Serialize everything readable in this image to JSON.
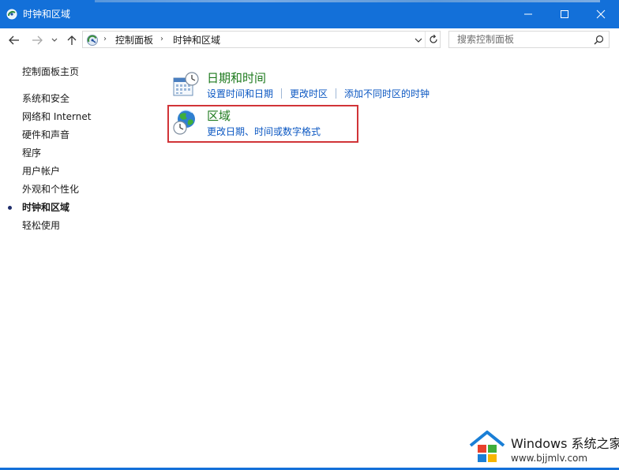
{
  "window": {
    "title": "时钟和区域"
  },
  "navigation": {
    "breadcrumb": [
      "控制面板",
      "时钟和区域"
    ],
    "search_placeholder": "搜索控制面板"
  },
  "sidebar": {
    "home": "控制面板主页",
    "items": [
      {
        "label": "系统和安全"
      },
      {
        "label": "网络和 Internet"
      },
      {
        "label": "硬件和声音"
      },
      {
        "label": "程序"
      },
      {
        "label": "用户帐户"
      },
      {
        "label": "外观和个性化"
      },
      {
        "label": "时钟和区域",
        "active": true
      },
      {
        "label": "轻松使用"
      }
    ]
  },
  "categories": [
    {
      "title": "日期和时间",
      "icon": "calendar-clock-icon",
      "links": [
        "设置时间和日期",
        "更改时区",
        "添加不同时区的时钟"
      ]
    },
    {
      "title": "区域",
      "icon": "globe-clock-icon",
      "links": [
        "更改日期、时间或数字格式"
      ]
    }
  ],
  "highlight_color": "#d13438",
  "watermark": {
    "brand": "Windows",
    "name": "系统之家",
    "url": "www.bjjmlv.com"
  },
  "colors": {
    "titlebar": "#1370d9",
    "category_title": "#1e7a1e",
    "link": "#0b57c2"
  }
}
